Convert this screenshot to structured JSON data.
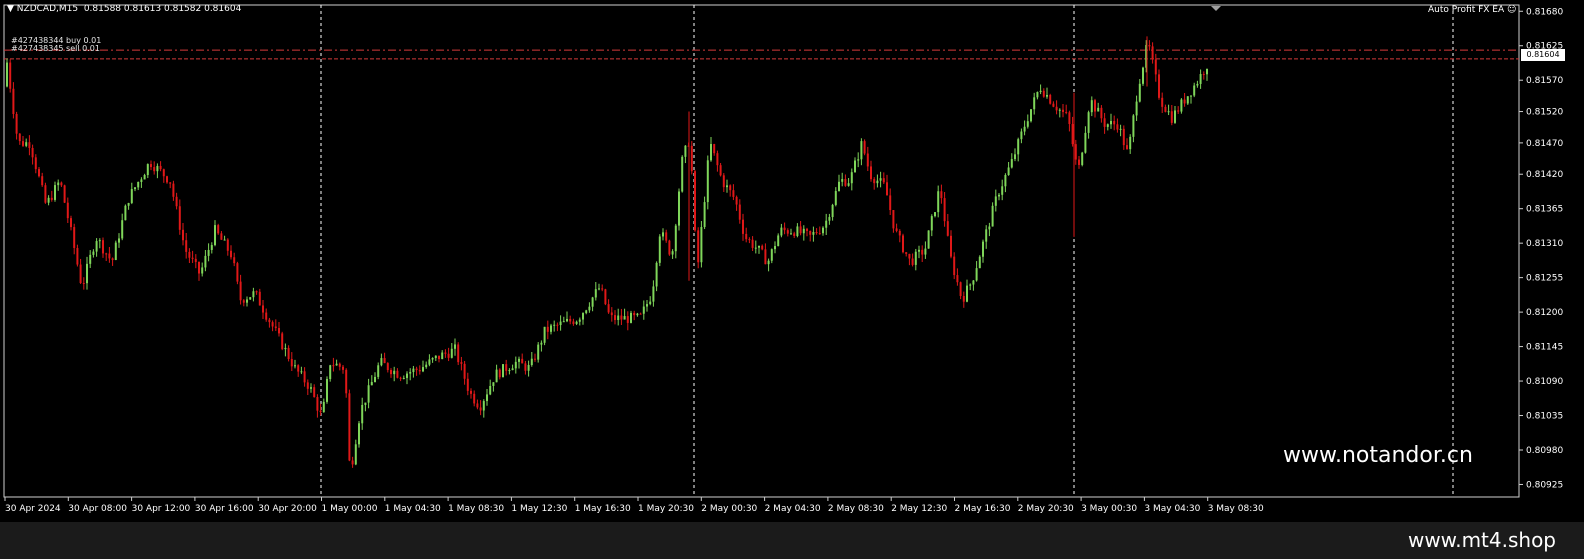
{
  "header": {
    "symbol": "NZDCAD,M15",
    "open": "0.81588",
    "high": "0.81613",
    "low": "0.81582",
    "close": "0.81604",
    "ea_name": "Auto Profit FX EA"
  },
  "orders": {
    "buy_label": "#427438344 buy 0.01",
    "sell_label": "#427438345 sell 0.01"
  },
  "current_price": "0.81604",
  "watermark": "www.notandor.cn",
  "footer_url": "www.mt4.shop",
  "colors": {
    "background": "#000000",
    "bull": "#7fd65a",
    "bear": "#e01818",
    "grid": "#ffffff",
    "order_line": "#d23b3b"
  },
  "chart_data": {
    "type": "candlestick",
    "title": "",
    "xlabel": "",
    "ylabel": "",
    "ylim": [
      0.80905,
      0.8169
    ],
    "y_ticks": [
      "0.81680",
      "0.81625",
      "0.81570",
      "0.81520",
      "0.81470",
      "0.81420",
      "0.81365",
      "0.81310",
      "0.81255",
      "0.81200",
      "0.81145",
      "0.81090",
      "0.81035",
      "0.80980",
      "0.80925"
    ],
    "x_ticks": [
      "30 Apr 2024",
      "30 Apr 08:00",
      "30 Apr 12:00",
      "30 Apr 16:00",
      "30 Apr 20:00",
      "1 May 00:00",
      "1 May 04:30",
      "1 May 08:30",
      "1 May 12:30",
      "1 May 16:30",
      "1 May 20:30",
      "2 May 00:30",
      "2 May 04:30",
      "2 May 08:30",
      "2 May 12:30",
      "2 May 16:30",
      "2 May 20:30",
      "3 May 00:30",
      "3 May 04:30",
      "3 May 08:30"
    ],
    "order_levels": [
      0.81618,
      0.81604
    ],
    "close_path": [
      [
        0,
        0.8156
      ],
      [
        6,
        0.8161
      ],
      [
        18,
        0.8147
      ],
      [
        30,
        0.8147
      ],
      [
        46,
        0.8137
      ],
      [
        60,
        0.8141
      ],
      [
        72,
        0.8132
      ],
      [
        82,
        0.8124
      ],
      [
        96,
        0.8132
      ],
      [
        112,
        0.8128
      ],
      [
        128,
        0.8138
      ],
      [
        150,
        0.8144
      ],
      [
        170,
        0.8141
      ],
      [
        185,
        0.813
      ],
      [
        200,
        0.8126
      ],
      [
        215,
        0.8133
      ],
      [
        232,
        0.8129
      ],
      [
        240,
        0.8122
      ],
      [
        255,
        0.8123
      ],
      [
        275,
        0.8117
      ],
      [
        295,
        0.8111
      ],
      [
        310,
        0.8108
      ],
      [
        322,
        0.8103
      ],
      [
        330,
        0.8112
      ],
      [
        345,
        0.8111
      ],
      [
        350,
        0.8094
      ],
      [
        360,
        0.8104
      ],
      [
        380,
        0.8112
      ],
      [
        400,
        0.811
      ],
      [
        420,
        0.8111
      ],
      [
        440,
        0.8113
      ],
      [
        455,
        0.8114
      ],
      [
        470,
        0.8107
      ],
      [
        480,
        0.8105
      ],
      [
        495,
        0.811
      ],
      [
        515,
        0.8112
      ],
      [
        530,
        0.8111
      ],
      [
        545,
        0.8117
      ],
      [
        560,
        0.8118
      ],
      [
        578,
        0.8119
      ],
      [
        600,
        0.8124
      ],
      [
        610,
        0.8119
      ],
      [
        625,
        0.8119
      ],
      [
        640,
        0.8119
      ],
      [
        652,
        0.8123
      ],
      [
        660,
        0.8133
      ],
      [
        672,
        0.8129
      ],
      [
        682,
        0.8144
      ],
      [
        690,
        0.8148
      ],
      [
        697,
        0.8126
      ],
      [
        710,
        0.8147
      ],
      [
        722,
        0.8141
      ],
      [
        735,
        0.8138
      ],
      [
        745,
        0.8132
      ],
      [
        758,
        0.813
      ],
      [
        768,
        0.8128
      ],
      [
        780,
        0.8133
      ],
      [
        795,
        0.8133
      ],
      [
        810,
        0.8132
      ],
      [
        825,
        0.8134
      ],
      [
        840,
        0.8141
      ],
      [
        850,
        0.8141
      ],
      [
        862,
        0.8147
      ],
      [
        870,
        0.8142
      ],
      [
        885,
        0.814
      ],
      [
        895,
        0.8133
      ],
      [
        910,
        0.8128
      ],
      [
        925,
        0.813
      ],
      [
        940,
        0.814
      ],
      [
        950,
        0.8129
      ],
      [
        962,
        0.8122
      ],
      [
        972,
        0.8125
      ],
      [
        985,
        0.8132
      ],
      [
        998,
        0.8139
      ],
      [
        1012,
        0.8144
      ],
      [
        1025,
        0.815
      ],
      [
        1040,
        0.8156
      ],
      [
        1055,
        0.8153
      ],
      [
        1068,
        0.8151
      ],
      [
        1078,
        0.8142
      ],
      [
        1090,
        0.8154
      ],
      [
        1105,
        0.815
      ],
      [
        1118,
        0.815
      ],
      [
        1128,
        0.8145
      ],
      [
        1138,
        0.8156
      ],
      [
        1148,
        0.8163
      ],
      [
        1160,
        0.8154
      ],
      [
        1172,
        0.8151
      ],
      [
        1185,
        0.8154
      ],
      [
        1198,
        0.8157
      ],
      [
        1210,
        0.81604
      ]
    ],
    "highlight_wicks": [
      {
        "x": 689,
        "high": 0.8152,
        "low": 0.8125
      },
      {
        "x": 1074,
        "high": 0.8155,
        "low": 0.8132
      },
      {
        "x": 1147,
        "high": 0.8164,
        "low": 0.8156
      }
    ]
  }
}
